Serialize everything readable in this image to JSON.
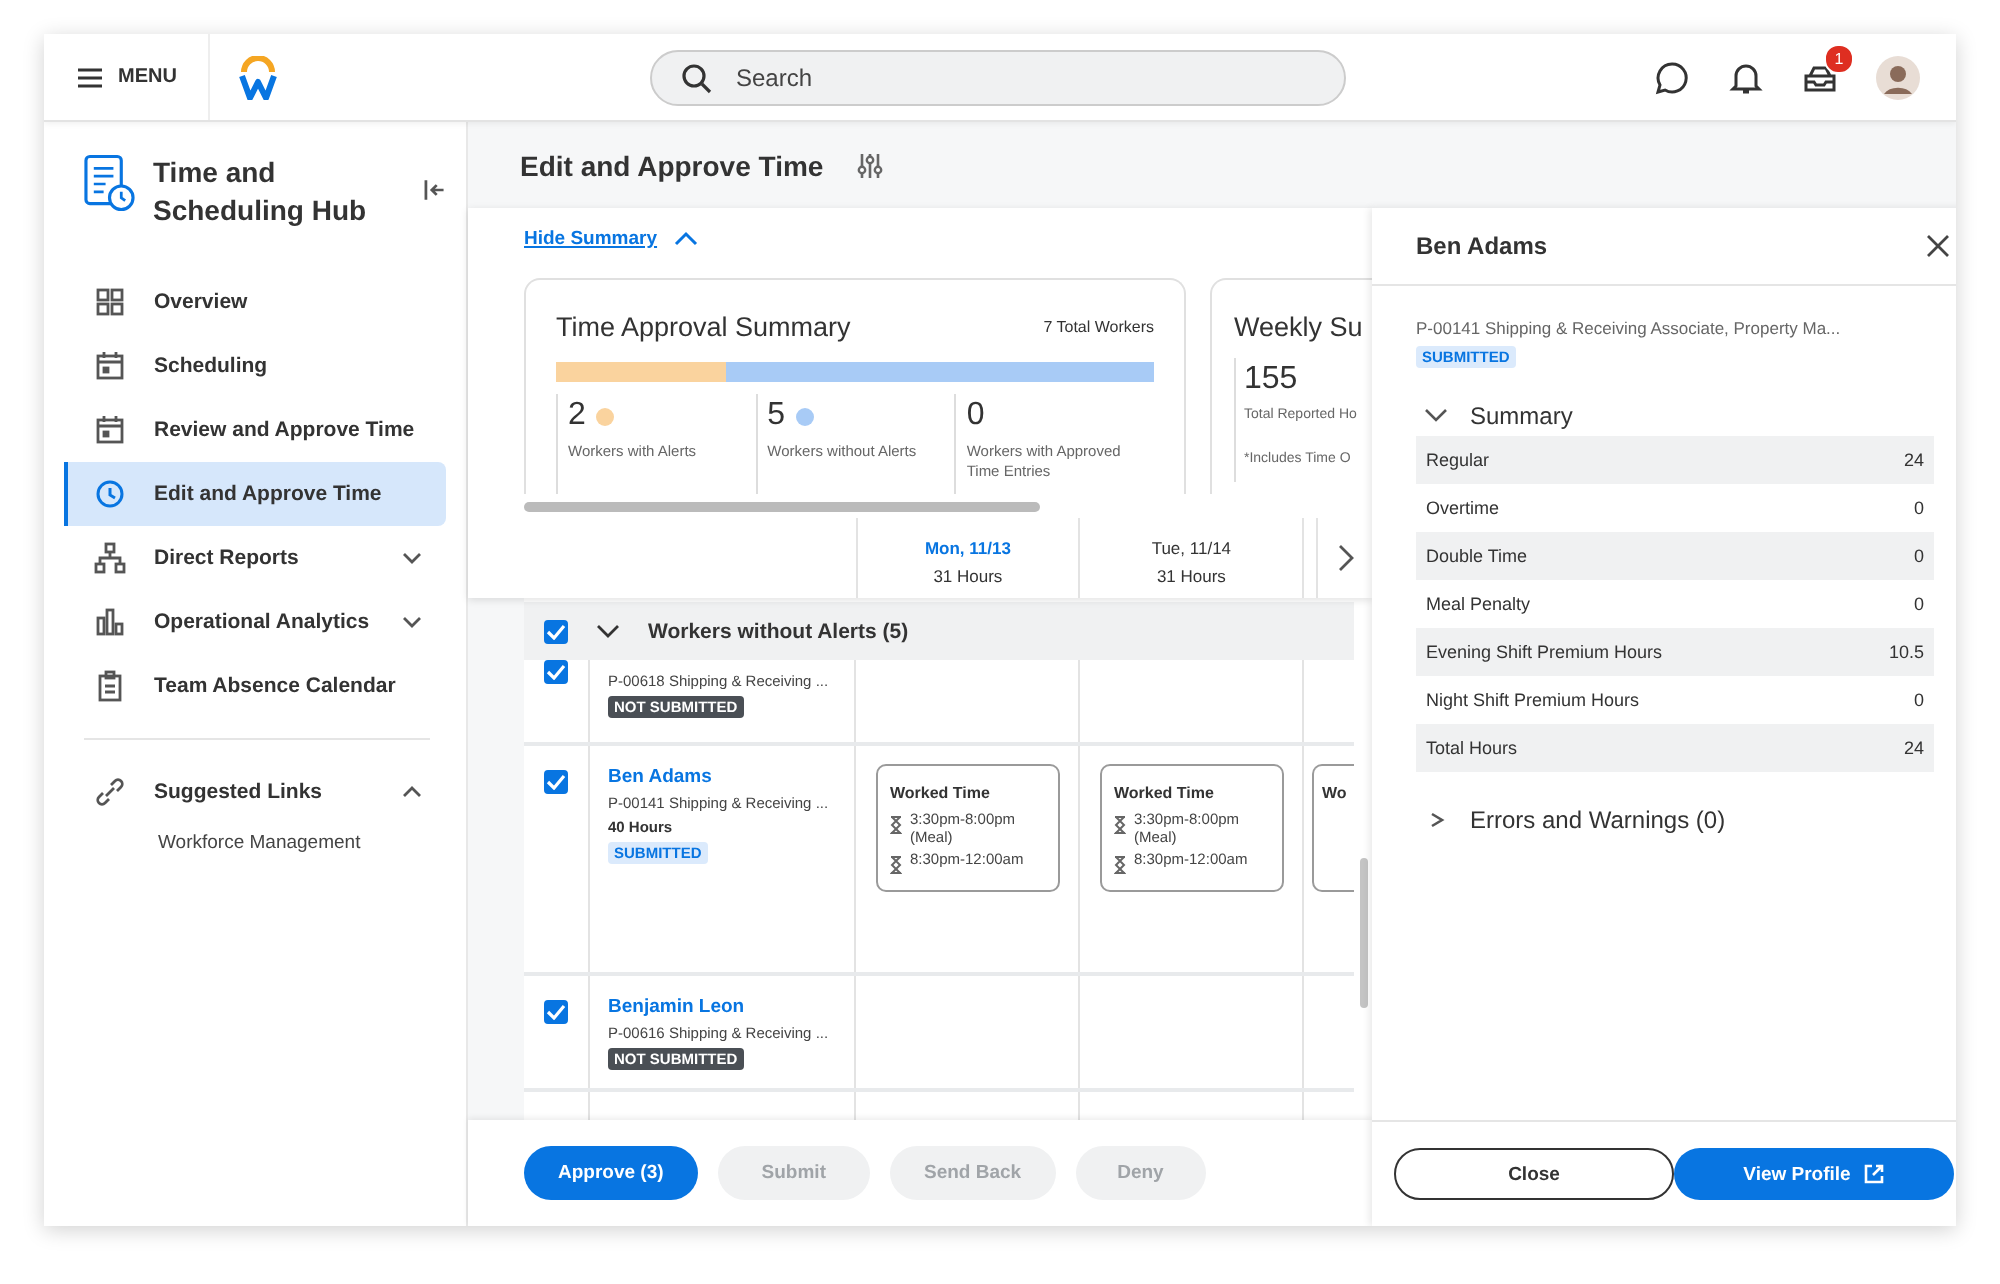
{
  "topbar": {
    "menu_label": "MENU",
    "search": {
      "placeholder": "Search"
    },
    "inbox_badge": "1"
  },
  "sidebar": {
    "title": "Time and Scheduling Hub",
    "items": [
      {
        "label": "Overview",
        "selected": false
      },
      {
        "label": "Scheduling",
        "selected": false
      },
      {
        "label": "Review and Approve Time",
        "selected": false
      },
      {
        "label": "Edit and Approve Time",
        "selected": true
      },
      {
        "label": "Direct Reports",
        "selected": false,
        "expanded": false
      },
      {
        "label": "Operational Analytics",
        "selected": false,
        "expanded": false
      },
      {
        "label": "Team Absence Calendar",
        "selected": false
      }
    ],
    "suggested": {
      "label": "Suggested Links",
      "expanded": true,
      "children": [
        {
          "label": "Workforce Management"
        }
      ]
    }
  },
  "main": {
    "title": "Edit and Approve Time",
    "summary_toggle": {
      "label": "Hide Summary",
      "expanded": true
    },
    "approval_card": {
      "title": "Time Approval Summary",
      "total": "7 Total Workers",
      "stats": [
        {
          "value": "2",
          "label": "Workers with Alerts",
          "color": "#fad39e"
        },
        {
          "value": "5",
          "label": "Workers without Alerts",
          "color": "#a8cbf6"
        },
        {
          "value": "0",
          "label": "Workers with Approved Time Entries"
        }
      ]
    },
    "weekly_card": {
      "title": "Weekly Su",
      "value": "155",
      "label": "Total Reported Ho",
      "note": "*Includes Time O"
    },
    "days": [
      {
        "label": "Mon, 11/13",
        "hours": "31 Hours",
        "selected": true
      },
      {
        "label": "Tue, 11/14",
        "hours": "31 Hours",
        "selected": false
      }
    ],
    "group": {
      "label": "Workers without Alerts (5)",
      "checked": true,
      "expanded": true
    },
    "rows": [
      {
        "checked": true,
        "position": "P-00618 Shipping & Receiving ...",
        "status": {
          "label": "NOT SUBMITTED",
          "kind": "not_submitted"
        }
      },
      {
        "checked": true,
        "name": "Ben Adams",
        "position": "P-00141 Shipping & Receiving ...",
        "hours": "40 Hours",
        "status": {
          "label": "SUBMITTED",
          "kind": "submitted"
        },
        "cells": [
          {
            "title": "Worked Time",
            "entries": [
              "3:30pm-8:00pm (Meal)",
              "8:30pm-12:00am"
            ]
          },
          {
            "title": "Worked Time",
            "entries": [
              "3:30pm-8:00pm (Meal)",
              "8:30pm-12:00am"
            ]
          },
          {
            "title": "Wo"
          }
        ]
      },
      {
        "checked": true,
        "name": "Benjamin Leon",
        "position": "P-00616 Shipping & Receiving ...",
        "status": {
          "label": "NOT SUBMITTED",
          "kind": "not_submitted"
        }
      }
    ],
    "actions": [
      {
        "label": "Approve (3)",
        "disabled": false
      },
      {
        "label": "Submit",
        "disabled": true
      },
      {
        "label": "Send Back",
        "disabled": true
      },
      {
        "label": "Deny",
        "disabled": true
      }
    ]
  },
  "details": {
    "title": "Ben Adams",
    "position": "P-00141 Shipping & Receiving Associate, Property Ma...",
    "status": {
      "label": "SUBMITTED",
      "kind": "submitted"
    },
    "sections": [
      {
        "label": "Summary",
        "expanded": true,
        "rows": [
          {
            "label": "Regular",
            "value": "24"
          },
          {
            "label": "Overtime",
            "value": "0"
          },
          {
            "label": "Double Time",
            "value": "0"
          },
          {
            "label": "Meal Penalty",
            "value": "0"
          },
          {
            "label": "Evening Shift Premium Hours",
            "value": "10.5"
          },
          {
            "label": "Night Shift Premium Hours",
            "value": "0"
          },
          {
            "label": "Total Hours",
            "value": "24"
          }
        ]
      },
      {
        "label": "Errors and Warnings (0)",
        "expanded": false
      }
    ],
    "buttons": [
      {
        "label": "Close",
        "kind": "secondary"
      },
      {
        "label": "View Profile",
        "kind": "primary",
        "external": true
      }
    ]
  }
}
